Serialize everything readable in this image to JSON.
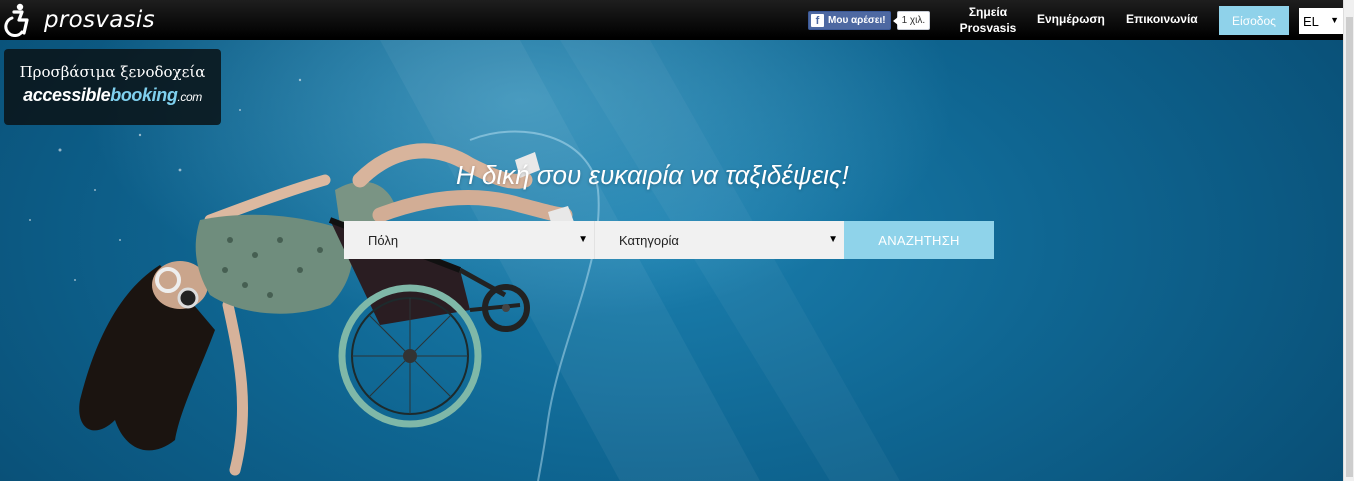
{
  "header": {
    "logo_icon": "wheelchair-icon",
    "logo_text": "prosvasis",
    "facebook": {
      "like_label": "Μου αρέσει!",
      "count": "1 χιλ."
    },
    "nav": [
      {
        "label_line1": "Σημεία",
        "label_line2": "Prosvasis"
      },
      {
        "label": "Ενημέρωση"
      },
      {
        "label": "Επικοινωνία"
      }
    ],
    "login_label": "Είσοδος",
    "language": "EL"
  },
  "hero": {
    "promo": {
      "title": "Προσβάσιμα ξενοδοχεία",
      "brand_part1": "accessible",
      "brand_part2": "booking",
      "brand_part3": ".com"
    },
    "headline": "Η δική σου ευκαιρία να ταξιδέψεις!",
    "search": {
      "city_placeholder": "Πόλη",
      "category_placeholder": "Κατηγορία",
      "button_label": "ΑΝΑΖΗΤΗΣΗ"
    }
  },
  "colors": {
    "accent": "#8fd3ea",
    "water": "#0f6692"
  }
}
